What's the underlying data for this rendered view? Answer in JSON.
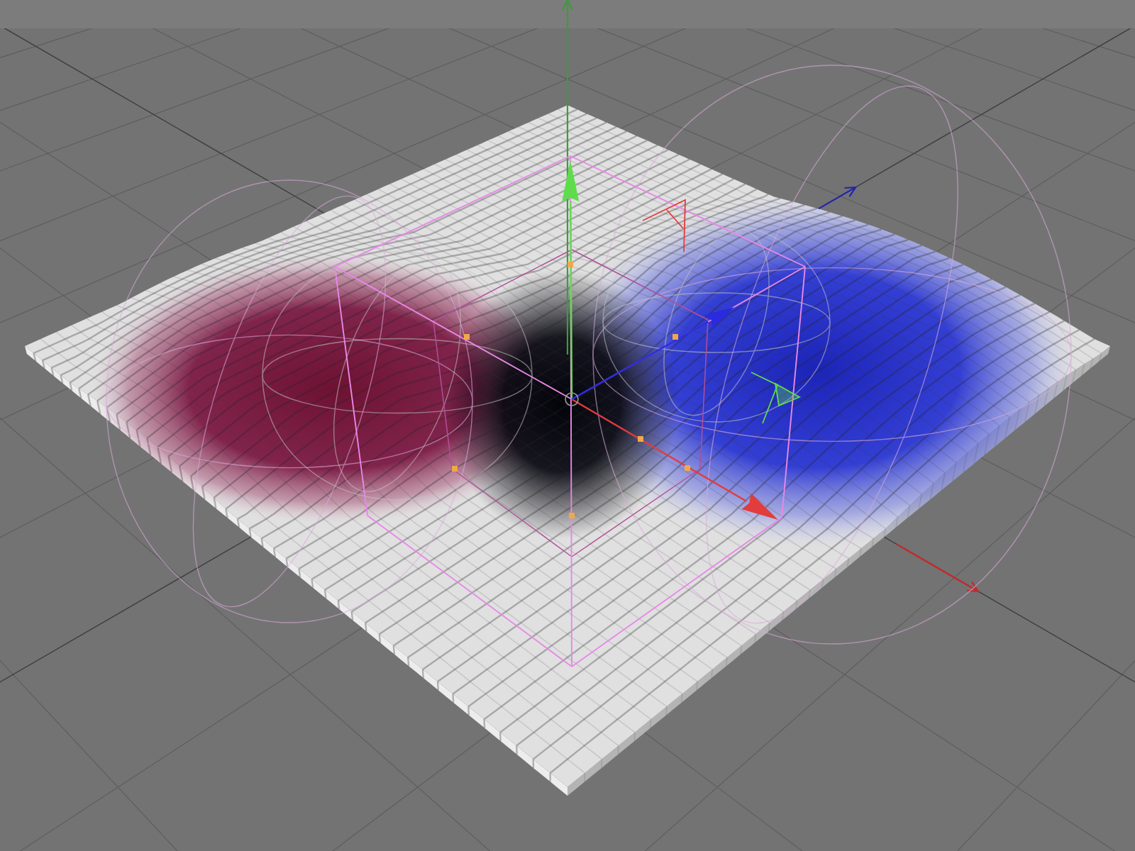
{
  "viewport": {
    "gizmo_axes": [
      {
        "color": "#e23c3c"
      },
      {
        "color": "#5fdc4c"
      },
      {
        "color": "#2a2ae0"
      }
    ],
    "world_axes": [
      {
        "color": "#c42a2a"
      },
      {
        "color": "#3c9c3c"
      },
      {
        "color": "#2424b0"
      }
    ]
  }
}
